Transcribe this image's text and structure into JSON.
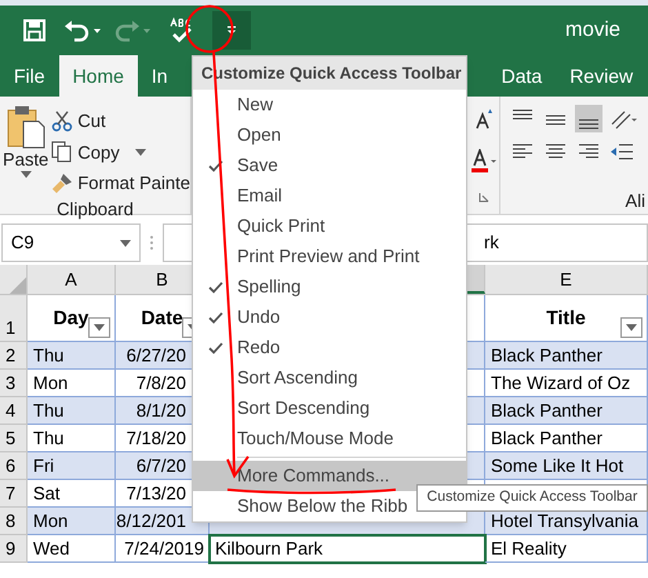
{
  "window": {
    "title": "movie"
  },
  "quick_access": [
    {
      "kind": "save",
      "disabled": false
    },
    {
      "kind": "undo",
      "disabled": false
    },
    {
      "kind": "redo",
      "disabled": true
    },
    {
      "kind": "spelling",
      "disabled": false
    },
    {
      "kind": "customize",
      "disabled": false
    }
  ],
  "tabs": [
    {
      "label": "File",
      "selected": false
    },
    {
      "label": "Home",
      "selected": true
    },
    {
      "label": "In",
      "selected": false
    },
    {
      "label": "Data",
      "selected": false
    },
    {
      "label": "Review",
      "selected": false
    }
  ],
  "ribbon": {
    "paste": "Paste",
    "cut": "Cut",
    "copy": "Copy",
    "format_painter": "Format Painte",
    "clipboard_group": "Clipboard",
    "alignment_group": "Ali"
  },
  "formula_bar": {
    "name_box": "C9",
    "value": "rk"
  },
  "columns": [
    "A",
    "B",
    "",
    "E"
  ],
  "header_row": {
    "number": "1",
    "cells": [
      "Day",
      "Date",
      "",
      "Title"
    ]
  },
  "rows": [
    {
      "number": "2",
      "selected": false,
      "cells": [
        "Thu",
        "6/27/20",
        "",
        "Black Panther"
      ]
    },
    {
      "number": "3",
      "selected": false,
      "cells": [
        "Mon",
        "7/8/20",
        "",
        "The Wizard of Oz"
      ]
    },
    {
      "number": "4",
      "selected": false,
      "cells": [
        "Thu",
        "8/1/20",
        "",
        "Black Panther"
      ]
    },
    {
      "number": "5",
      "selected": false,
      "cells": [
        "Thu",
        "7/18/20",
        "",
        "Black Panther"
      ]
    },
    {
      "number": "6",
      "selected": false,
      "cells": [
        "Fri",
        "6/7/20",
        "",
        "Some Like It Hot"
      ]
    },
    {
      "number": "7",
      "selected": false,
      "cells": [
        "Sat",
        "7/13/20",
        "",
        ""
      ]
    },
    {
      "number": "8",
      "selected": false,
      "cells": [
        "Mon",
        "8/12/201",
        "",
        "Hotel Transylvania"
      ]
    },
    {
      "number": "9",
      "selected": true,
      "cells": [
        "Wed",
        "7/24/2019",
        "Kilbourn Park",
        "El Reality"
      ]
    }
  ],
  "menu": {
    "title": "Customize Quick Access Toolbar",
    "items": [
      {
        "label": "New",
        "kind": "option",
        "checked": false,
        "selected": false
      },
      {
        "label": "Open",
        "kind": "option",
        "checked": false,
        "selected": false
      },
      {
        "label": "Save",
        "kind": "option",
        "checked": true,
        "selected": false
      },
      {
        "label": "Email",
        "kind": "option",
        "checked": false,
        "selected": false
      },
      {
        "label": "Quick Print",
        "kind": "option",
        "checked": false,
        "selected": false
      },
      {
        "label": "Print Preview and Print",
        "kind": "option",
        "checked": false,
        "selected": false
      },
      {
        "label": "Spelling",
        "kind": "option",
        "checked": true,
        "selected": false
      },
      {
        "label": "Undo",
        "kind": "option",
        "checked": true,
        "selected": false
      },
      {
        "label": "Redo",
        "kind": "option",
        "checked": true,
        "selected": false
      },
      {
        "label": "Sort Ascending",
        "kind": "option",
        "checked": false,
        "selected": false
      },
      {
        "label": "Sort Descending",
        "kind": "option",
        "checked": false,
        "selected": false
      },
      {
        "label": "Touch/Mouse Mode",
        "kind": "option",
        "checked": false,
        "selected": false
      },
      {
        "label": "More Commands...",
        "kind": "action",
        "checked": false,
        "selected": true
      },
      {
        "label": "Show Below the Ribb",
        "kind": "action",
        "checked": false,
        "selected": false
      }
    ]
  },
  "tooltip": "Customize Quick Access Toolbar"
}
